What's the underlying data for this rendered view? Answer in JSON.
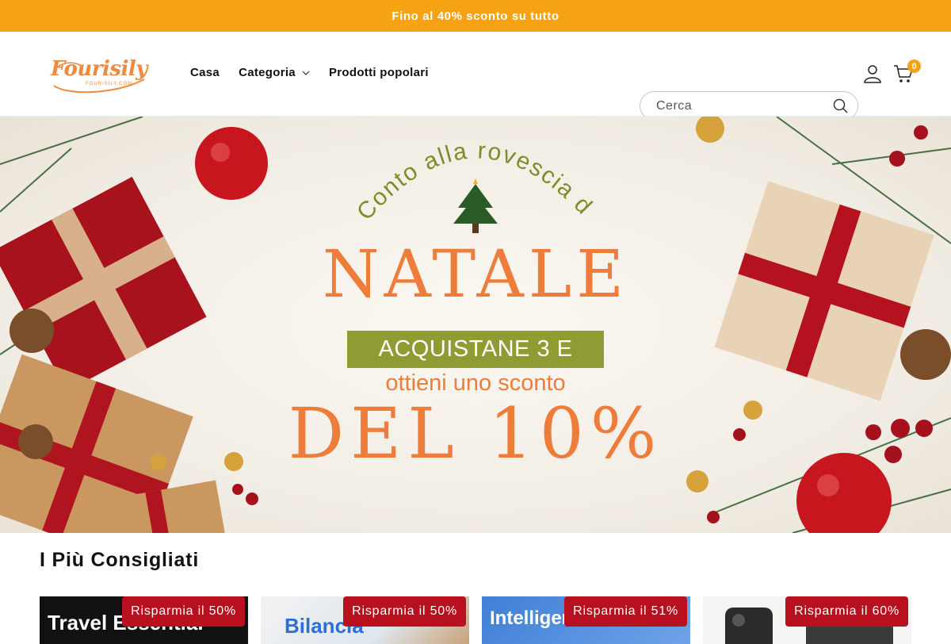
{
  "announcement": {
    "text": "Fino al 40% sconto su tutto"
  },
  "header": {
    "logo": {
      "text": "Fourisily",
      "subtext": "FOURISILY.COM"
    },
    "nav": [
      {
        "label": "Casa"
      },
      {
        "label": "Categoria"
      },
      {
        "label": "Prodotti popolari"
      }
    ],
    "search": {
      "placeholder": "Cerca"
    },
    "cart": {
      "count": "0"
    }
  },
  "hero": {
    "arc_text": "Conto alla rovescia di",
    "title": "NATALE",
    "band_text": "ACQUISTANE 3 E",
    "subtitle": "ottieni uno sconto",
    "big_text": "DEL 10%"
  },
  "section": {
    "title": "I Più Consigliati"
  },
  "products": [
    {
      "badge": "Risparmia il 50%",
      "image_text": "Travel Essential"
    },
    {
      "badge": "Risparmia il 50%",
      "image_text": "Bilancia"
    },
    {
      "badge": "Risparmia il 51%",
      "image_text": "Intelligen"
    },
    {
      "badge": "Risparmia il 60%",
      "image_text": ""
    }
  ],
  "colors": {
    "accent": "#f5a314",
    "badge": "#b8101f",
    "hero_text": "#ee7c3a",
    "band": "#8f9b33"
  }
}
